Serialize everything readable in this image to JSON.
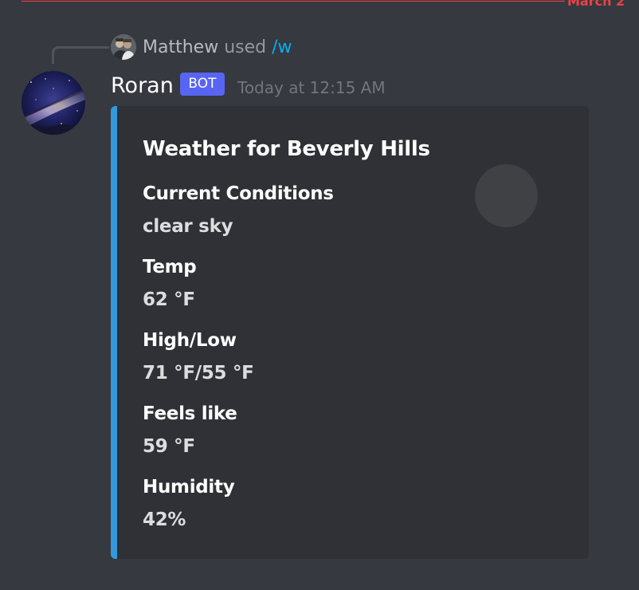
{
  "divider": {
    "label": "March 2"
  },
  "command_reply": {
    "user": "Matthew",
    "used_text": "used",
    "command": "/w"
  },
  "message": {
    "author": "Roran",
    "badge": "BOT",
    "timestamp": "Today at 12:15 AM"
  },
  "embed": {
    "accent_color": "#3498db",
    "title": "Weather for Beverly Hills",
    "fields": [
      {
        "name": "Current Conditions",
        "value": "clear sky"
      },
      {
        "name": "Temp",
        "value": "62 °F"
      },
      {
        "name": "High/Low",
        "value": "71 °F/55 °F"
      },
      {
        "name": "Feels like",
        "value": "59 °F"
      },
      {
        "name": "Humidity",
        "value": "42%"
      }
    ]
  },
  "colors": {
    "background": "#36393f",
    "embed_background": "#2f3136",
    "badge": "#5865f2",
    "divider": "#ed4245",
    "command": "#00aff4"
  },
  "icons": {
    "reply_avatar": "user-avatar-icon",
    "bot_avatar": "galaxy-avatar-icon",
    "thumbnail": "weather-thumbnail-placeholder"
  }
}
